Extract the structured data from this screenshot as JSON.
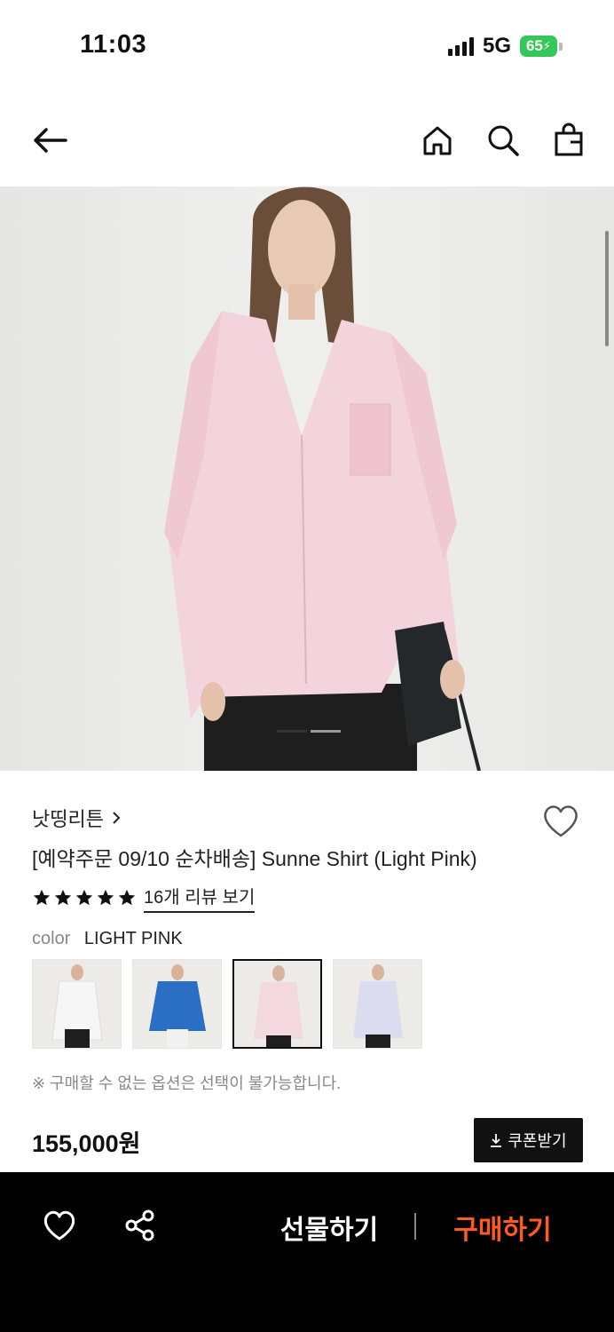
{
  "status": {
    "time": "11:03",
    "network": "5G",
    "battery": "65"
  },
  "nav": {
    "back_icon": "arrow-left-icon",
    "home_icon": "home-icon",
    "search_icon": "search-icon",
    "bag_icon": "shopping-bag-icon"
  },
  "product": {
    "brand": "낫띵리튼",
    "title": "[예약주문 09/10 순차배송] Sunne Shirt (Light Pink)",
    "rating_stars": 5,
    "reviews_link": "16개 리뷰 보기",
    "color_label": "color",
    "color_value": "LIGHT PINK",
    "swatches": [
      {
        "name": "white",
        "shirt": "#f6f6f6"
      },
      {
        "name": "blue",
        "shirt": "#2b6fc4"
      },
      {
        "name": "light-pink",
        "shirt": "#f4d8e0"
      },
      {
        "name": "light-blue",
        "shirt": "#dcdcf0"
      }
    ],
    "selected_swatch": 2,
    "notice": "※ 구매할 수 없는 옵션은 선택이 불가능합니다.",
    "price": "155,000원",
    "coupon_label": "쿠폰받기"
  },
  "bottom_bar": {
    "gift_label": "선물하기",
    "buy_label": "구매하기"
  },
  "colors": {
    "accent": "#ff5a1f",
    "battery": "#34c759"
  }
}
